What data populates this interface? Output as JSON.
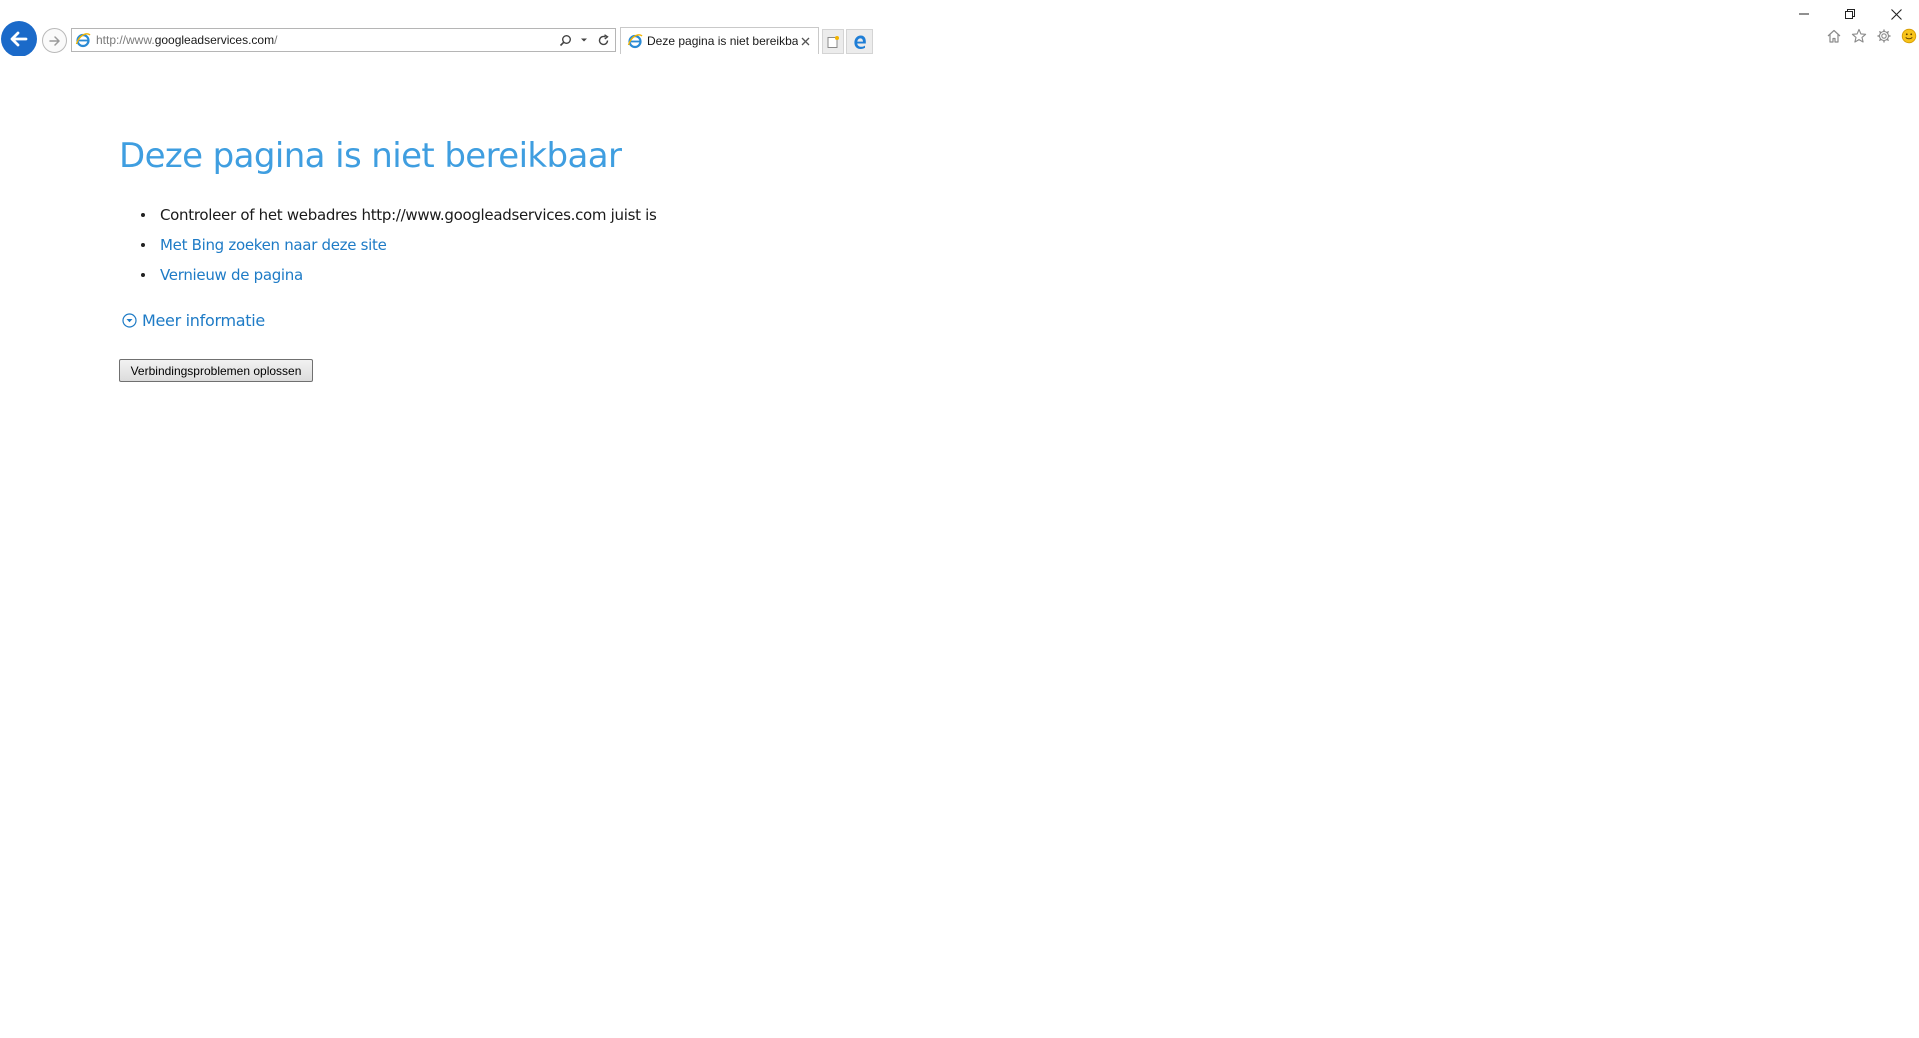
{
  "browser": {
    "address_bar": {
      "url_prefix": "http://www.",
      "url_domain": "googleadservices.com",
      "url_suffix": "/"
    },
    "tab": {
      "title": "Deze pagina is niet bereikba..."
    },
    "icons": {
      "back": "back-arrow-icon",
      "forward": "forward-arrow-icon",
      "favicon": "ie-favicon-icon",
      "search": "search-icon",
      "dropdown": "chevron-down-icon",
      "refresh": "refresh-icon",
      "close_tab": "close-icon",
      "new_tab": "new-tab-icon",
      "edge": "edge-icon",
      "home": "home-icon",
      "favorites": "star-icon",
      "settings": "gear-icon",
      "feedback": "smiley-icon"
    },
    "colors": {
      "back_button": "#1b6ac9",
      "title": "#3f9ee0",
      "link": "#1e7bc6"
    }
  },
  "page": {
    "title": "Deze pagina is niet bereikbaar",
    "suggestions": [
      {
        "text": "Controleer of het webadres http://www.googleadservices.com juist is",
        "link": false
      },
      {
        "text": "Met Bing zoeken naar deze site",
        "link": true
      },
      {
        "text": "Vernieuw de pagina",
        "link": true
      }
    ],
    "more_info_label": "Meer informatie",
    "diagnose_button_label": "Verbindingsproblemen oplossen"
  }
}
